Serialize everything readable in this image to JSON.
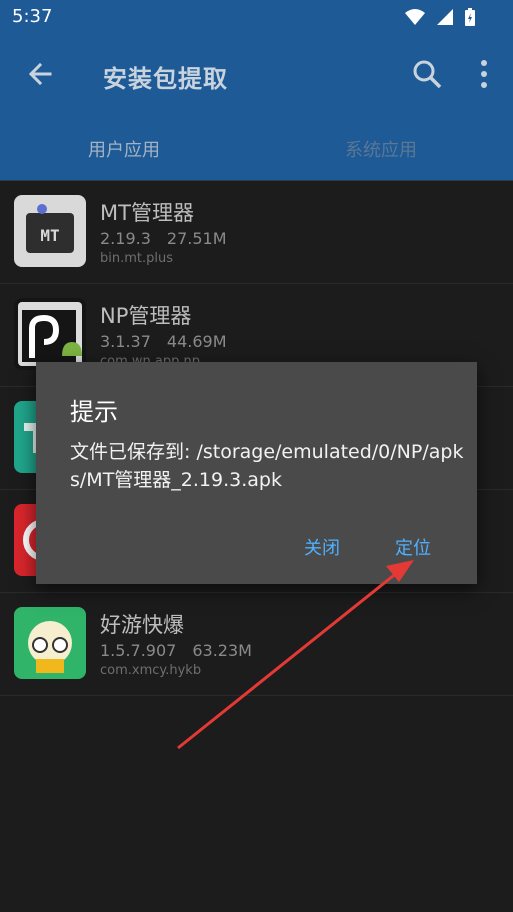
{
  "status": {
    "time": "5:37"
  },
  "appbar": {
    "title": "安装包提取",
    "back_icon": "arrow-back-icon",
    "search_icon": "search-icon",
    "more_icon": "more-vert-icon"
  },
  "tabs": [
    {
      "label": "用户应用"
    },
    {
      "label": "系统应用"
    }
  ],
  "apps": [
    {
      "name": "MT管理器",
      "version": "2.19.3",
      "size": "27.51M",
      "package": "bin.mt.plus"
    },
    {
      "name": "NP管理器",
      "version": "3.1.37",
      "size": "44.69M",
      "package": "com.wn.app.np"
    },
    {
      "name": "",
      "version": "",
      "size": "",
      "package": ""
    },
    {
      "name": "",
      "version": "",
      "size": "",
      "package": ""
    },
    {
      "name": "好游快爆",
      "version": "1.5.7.907",
      "size": "63.23M",
      "package": "com.xmcy.hykb"
    }
  ],
  "dialog": {
    "title": "提示",
    "message": "文件已保存到: /storage/emulated/0/NP/apks/MT管理器_2.19.3.apk",
    "close_label": "关闭",
    "locate_label": "定位"
  },
  "colors": {
    "primary": "#1e5a96",
    "background": "#1c1c1c",
    "dialog": "#4a4a4a",
    "accent": "#4fb0ff",
    "annotation": "#e53935"
  }
}
